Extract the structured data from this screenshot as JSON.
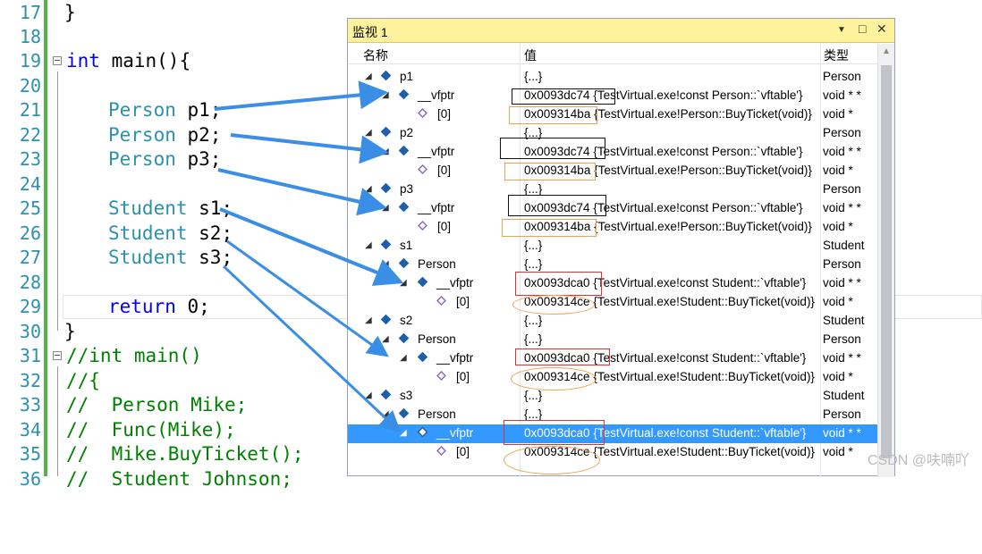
{
  "editor": {
    "lines": [
      {
        "num": "17",
        "text": "}"
      },
      {
        "num": "18",
        "text": ""
      },
      {
        "num": "19",
        "kw": "int",
        "text": " main(){"
      },
      {
        "num": "20",
        "text": ""
      },
      {
        "num": "21",
        "ty": "Person",
        "text": " p1;"
      },
      {
        "num": "22",
        "ty": "Person",
        "text": " p2;"
      },
      {
        "num": "23",
        "ty": "Person",
        "text": " p3;"
      },
      {
        "num": "24",
        "text": ""
      },
      {
        "num": "25",
        "ty": "Student",
        "text": " s1;"
      },
      {
        "num": "26",
        "ty": "Student",
        "text": " s2;"
      },
      {
        "num": "27",
        "ty": "Student",
        "text": " s3;"
      },
      {
        "num": "28",
        "text": ""
      },
      {
        "num": "29",
        "kw": "return",
        "text": " 0;"
      },
      {
        "num": "30",
        "text": "}"
      },
      {
        "num": "31",
        "cm": "//int main()"
      },
      {
        "num": "32",
        "cm": "//{"
      },
      {
        "num": "33",
        "cm": "//  Person Mike;"
      },
      {
        "num": "34",
        "cm": "//  Func(Mike);"
      },
      {
        "num": "35",
        "cm": "//  Mike.BuyTicket();"
      },
      {
        "num": "36",
        "cm": "//  Student Johnson;"
      }
    ]
  },
  "watch": {
    "title": "监视 1",
    "controls": {
      "dropdown": "▼",
      "maximize": "□",
      "close": "✕"
    },
    "headers": {
      "name": "名称",
      "value": "值",
      "type": "类型"
    },
    "rows": [
      {
        "name": "p1",
        "value": "{...}",
        "type": "Person"
      },
      {
        "name": "__vfptr",
        "value": "0x0093dc74 {TestVirtual.exe!const Person::`vftable'}",
        "type": "void * *"
      },
      {
        "name": "[0]",
        "value": "0x009314ba {TestVirtual.exe!Person::BuyTicket(void)}",
        "type": "void *"
      },
      {
        "name": "p2",
        "value": "{...}",
        "type": "Person"
      },
      {
        "name": "__vfptr",
        "value": "0x0093dc74 {TestVirtual.exe!const Person::`vftable'}",
        "type": "void * *"
      },
      {
        "name": "[0]",
        "value": "0x009314ba {TestVirtual.exe!Person::BuyTicket(void)}",
        "type": "void *"
      },
      {
        "name": "p3",
        "value": "{...}",
        "type": "Person"
      },
      {
        "name": "__vfptr",
        "value": "0x0093dc74 {TestVirtual.exe!const Person::`vftable'}",
        "type": "void * *"
      },
      {
        "name": "[0]",
        "value": "0x009314ba {TestVirtual.exe!Person::BuyTicket(void)}",
        "type": "void *"
      },
      {
        "name": "s1",
        "value": "{...}",
        "type": "Student"
      },
      {
        "name": "Person",
        "value": "{...}",
        "type": "Person"
      },
      {
        "name": "__vfptr",
        "value": "0x0093dca0 {TestVirtual.exe!const Student::`vftable'}",
        "type": "void * *"
      },
      {
        "name": "[0]",
        "value": "0x009314ce {TestVirtual.exe!Student::BuyTicket(void)}",
        "type": "void *"
      },
      {
        "name": "s2",
        "value": "{...}",
        "type": "Student"
      },
      {
        "name": "Person",
        "value": "{...}",
        "type": "Person"
      },
      {
        "name": "__vfptr",
        "value": "0x0093dca0 {TestVirtual.exe!const Student::`vftable'}",
        "type": "void * *"
      },
      {
        "name": "[0]",
        "value": "0x009314ce {TestVirtual.exe!Student::BuyTicket(void)}",
        "type": "void *"
      },
      {
        "name": "s3",
        "value": "{...}",
        "type": "Student"
      },
      {
        "name": "Person",
        "value": "{...}",
        "type": "Person"
      },
      {
        "name": "__vfptr",
        "value": "0x0093dca0 {TestVirtual.exe!const Student::`vftable'}",
        "type": "void * *"
      },
      {
        "name": "[0]",
        "value": "0x009314ce {TestVirtual.exe!Student::BuyTicket(void)}",
        "type": "void *"
      }
    ]
  },
  "watermark": "CSDN @呋喃吖",
  "colors": {
    "accent_green": "#57b04a",
    "selection": "#3399ff",
    "arrow": "#3a8ee6",
    "title_bar": "#fff29d"
  }
}
